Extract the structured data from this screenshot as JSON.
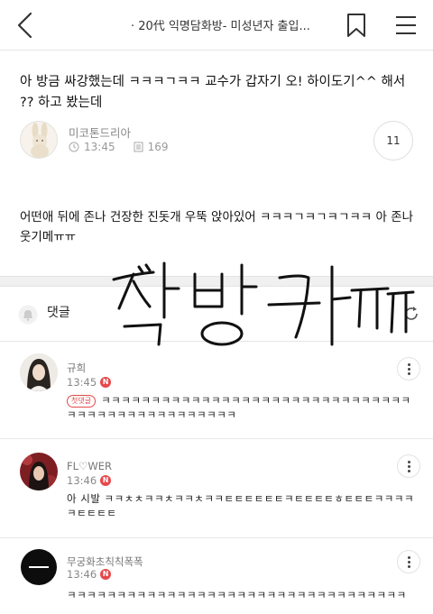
{
  "header": {
    "back_icon": "chevron-left-icon",
    "title": "· 20代 익명담화방- 미성년자 출입...",
    "bookmark_icon": "bookmark-icon",
    "menu_icon": "hamburger-menu-icon"
  },
  "post": {
    "title": "아 방금 싸강했는데 ㅋㅋㅋㄱㅋㅋ 교수가 갑자기 오! 하이도기^^ 해서 ?? 하고 봤는데",
    "author": "미코톤드리아",
    "time": "13:45",
    "views": "169",
    "comment_count": "11",
    "body": "어떤애 뒤에 존나 건장한 진돗개 우뚝 앉아있어 ㅋㅋㅋㄱㅋㄱㅋㄱㅋㅋ 아 존나 웃기메ㅠㅠ"
  },
  "comments_section": {
    "label": "댓글"
  },
  "comments": [
    {
      "name": "규희",
      "time": "13:45",
      "badge": "N",
      "first_badge": "첫댓글",
      "text": "ㅋㅋㅋㅋㅋㅋㅋㅋㅋㅋㅋㅋㅋㅋㅋㅋㅋㅋㅋㅋㅋㅋㅋㅋㅋㅋㅋㅋㅋㅋㅋㅋㅋㅋㅋㅋㅋㅋㅋㅋㅋㅋㅋㅋㅋㅋㅋㅋ"
    },
    {
      "name": "FL♡WER",
      "time": "13:46",
      "badge": "N",
      "text": "아 시발 ㅋㅋㅊㅊㅋㅋㅊㅋㅋㅊㅋㅋㅌㅌㅌㅌㅌㅌㅋㅌㅌㅌㅌㅎㅌㅌㅌㅋㅋㅋㅋㅋㅌㅌㅌㅌ"
    },
    {
      "name": "무궁화초칙칙폭폭",
      "time": "13:46",
      "badge": "N",
      "text": "ㅋㅋㅋㅋㅋㅋㅋㅋㅋㅋㅋㅋㅋㅋㅋㅋㅋㅋㅋㅋㅋㅋㅋㅋㅋㅋㅋㅋㅋㅋㅋㅋㅋㅋ"
    }
  ],
  "overlay": {
    "handwritten_text": "짝방가ㅠㅠ"
  },
  "colors": {
    "badge_red": "#e8484b",
    "divider": "#e6e6e6",
    "muted": "#888888"
  }
}
